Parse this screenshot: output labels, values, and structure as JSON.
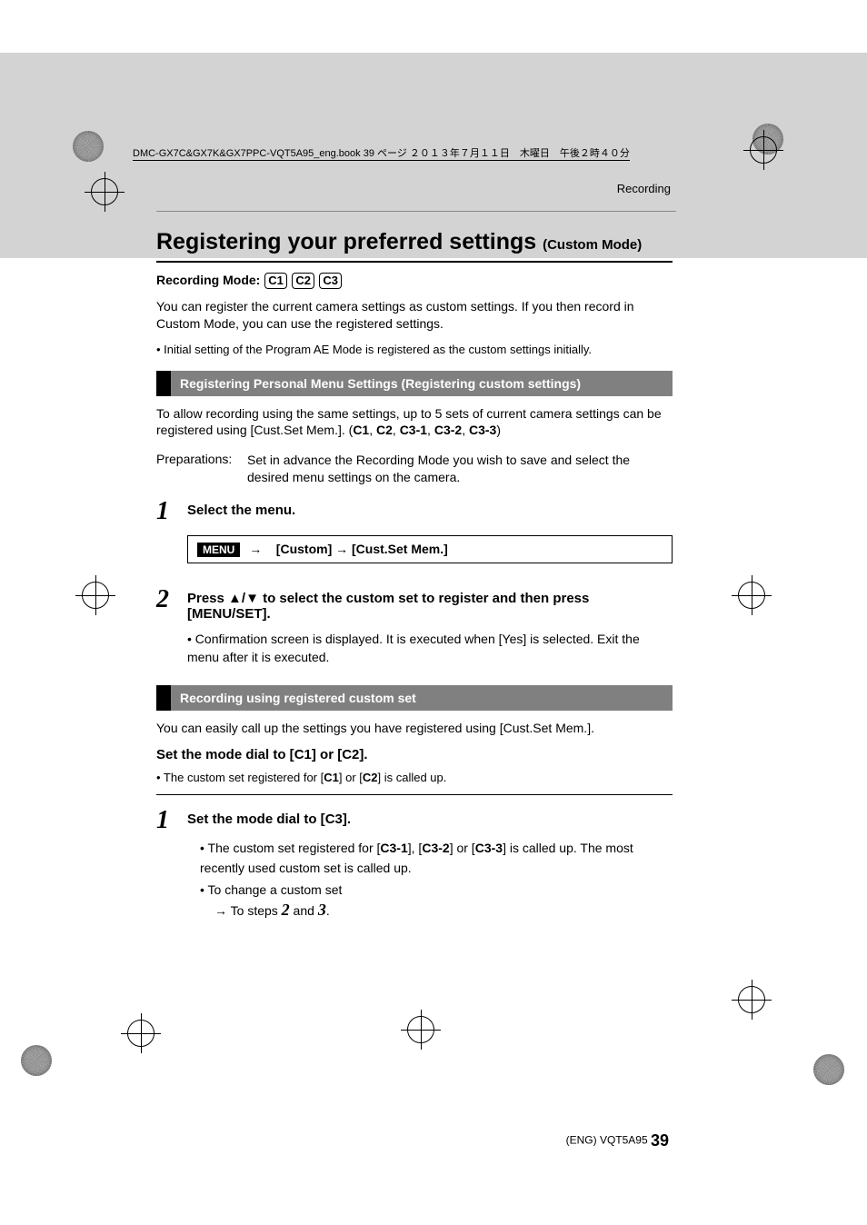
{
  "header_label": "DMC-GX7C&GX7K&GX7PPC-VQT5A95_eng.book  39 ページ  ２０１３年７月１１日　木曜日　午後２時４０分",
  "section_label": "Recording",
  "title": "Registering your preferred settings ",
  "title_sub": "(Custom Mode)",
  "rec_mode_label": "Recording Mode: ",
  "mode_chips": {
    "c1": "C1",
    "c2": "C2",
    "c3": "C3"
  },
  "intro1": "You can register the current camera settings as custom settings. If you then record in Custom Mode, you can use the registered settings.",
  "intro_bullet": "• Initial setting of the Program AE Mode is registered as the custom settings initially.",
  "sh1": "Registering Personal Menu Settings (Registering custom settings)",
  "sh1_body_pre": "To allow recording using the same settings, up to 5 sets of current camera settings can be registered using [Cust.Set Mem.]. (",
  "sh1_sets": {
    "a": "C1",
    "b": "C2",
    "c": "C3-1",
    "d": "C3-2",
    "e": "C3-3"
  },
  "sh1_body_post": ")",
  "prep_k": "Preparations:",
  "prep_v": "Set in advance the Recording Mode you wish to save and select the desired menu settings on the camera.",
  "step1_title": "Select the menu.",
  "menu_chip": "MENU",
  "menu_path_a": "[Custom]",
  "menu_path_b": "[Cust.Set Mem.]",
  "step2_title_a": "Press ",
  "step2_title_b": " to select the custom set to register and then press [MENU/SET].",
  "step2_bullet": "• Confirmation screen is displayed. It is executed when [Yes] is selected. Exit the menu after it is executed.",
  "sh2": "Recording using registered custom set",
  "sh2_body": "You can easily call up the settings you have registered using [Cust.Set Mem.].",
  "dial_h_pre": "Set the mode dial to [",
  "dial_h_c1": "C1",
  "dial_h_mid": "] or [",
  "dial_h_c2": "C2",
  "dial_h_post": "].",
  "dial_bullet_pre": "• The custom set registered for [",
  "dial_bullet_mid": "] or [",
  "dial_bullet_post": "] is called up.",
  "stepB1_pre": "Set the mode dial to [",
  "stepB1_c3": "C3",
  "stepB1_post": "].",
  "stepB1_b1_pre": "• The custom set registered for [",
  "stepB1_b1_a": "C3-1",
  "stepB1_b1_mid1": "], [",
  "stepB1_b1_b": "C3-2",
  "stepB1_b1_mid2": "] or [",
  "stepB1_b1_c": "C3-3",
  "stepB1_b1_post": "] is called up. The most recently used custom set is called up.",
  "stepB1_b2": "• To change a custom set",
  "stepB1_b3": "→ To steps ",
  "stepB1_b3_2": "2",
  "stepB1_b3_and": " and ",
  "stepB1_b3_3": "3",
  "stepB1_b3_dot": ".",
  "footer_code": "(ENG) VQT5A95 ",
  "footer_page": "39"
}
